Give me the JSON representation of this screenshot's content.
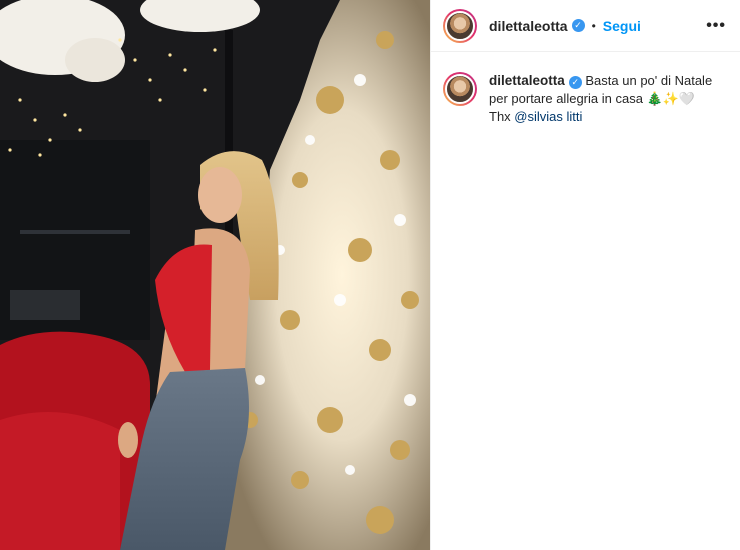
{
  "post": {
    "username": "dilettaleotta",
    "verified_icon": "verified-badge-icon",
    "follow_label": "Segui",
    "separator": "•",
    "more_label": "•••"
  },
  "caption": {
    "username": "dilettaleotta",
    "text_part1": "Basta un po' di Natale per portare allegria in casa",
    "emoji_tree": "🎄",
    "emoji_sparkles": "✨",
    "emoji_heart": "🤍",
    "thanks_label": "Thx",
    "mention": "@silvias litti"
  },
  "colors": {
    "accent_blue": "#0095f6",
    "verified_blue": "#3897f0",
    "mention_blue": "#00376b",
    "dress_red": "#d4202a"
  }
}
